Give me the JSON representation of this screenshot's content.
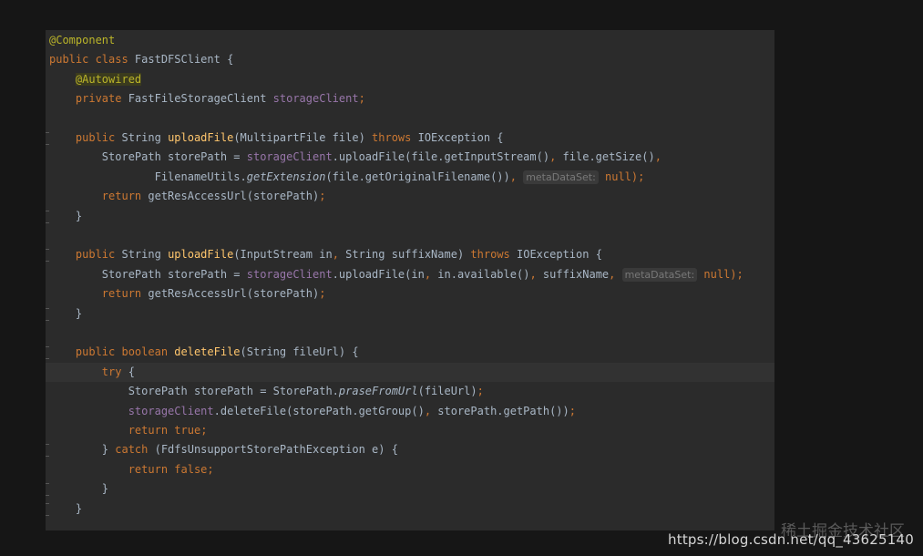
{
  "editor": {
    "lines": [
      {
        "tokens": [
          {
            "t": "@Component",
            "c": "ann"
          }
        ]
      },
      {
        "tokens": [
          {
            "t": "public class ",
            "c": "kw"
          },
          {
            "t": "FastDFSClient ",
            "c": "plain"
          },
          {
            "t": "{",
            "c": "plain"
          }
        ]
      },
      {
        "tokens": [
          {
            "t": "    ",
            "c": "plain"
          },
          {
            "t": "@Autowired",
            "c": "ann-hl"
          }
        ]
      },
      {
        "tokens": [
          {
            "t": "    ",
            "c": "plain"
          },
          {
            "t": "private ",
            "c": "kw"
          },
          {
            "t": "FastFileStorageClient ",
            "c": "plain"
          },
          {
            "t": "storageClient",
            "c": "field"
          },
          {
            "t": ";",
            "c": "punc"
          }
        ]
      },
      {
        "tokens": []
      },
      {
        "tokens": [
          {
            "t": "    ",
            "c": "plain"
          },
          {
            "t": "public ",
            "c": "kw"
          },
          {
            "t": "String ",
            "c": "plain"
          },
          {
            "t": "uploadFile",
            "c": "fn"
          },
          {
            "t": "(MultipartFile file) ",
            "c": "plain"
          },
          {
            "t": "throws ",
            "c": "kw"
          },
          {
            "t": "IOException {",
            "c": "plain"
          }
        ]
      },
      {
        "tokens": [
          {
            "t": "        ",
            "c": "plain"
          },
          {
            "t": "StorePath storePath = ",
            "c": "plain"
          },
          {
            "t": "storageClient",
            "c": "field"
          },
          {
            "t": ".uploadFile(file.getInputStream()",
            "c": "plain"
          },
          {
            "t": ", ",
            "c": "punc"
          },
          {
            "t": "file.getSize()",
            "c": "plain"
          },
          {
            "t": ",",
            "c": "punc"
          }
        ]
      },
      {
        "tokens": [
          {
            "t": "                ",
            "c": "plain"
          },
          {
            "t": "FilenameUtils.",
            "c": "plain"
          },
          {
            "t": "getExtension",
            "c": "static"
          },
          {
            "t": "(file.getOriginalFilename())",
            "c": "plain"
          },
          {
            "t": ", ",
            "c": "punc"
          },
          {
            "t": "metaDataSet:",
            "c": "hint"
          },
          {
            "t": " null",
            "c": "kw"
          },
          {
            "t": ");",
            "c": "punc"
          }
        ]
      },
      {
        "tokens": [
          {
            "t": "        ",
            "c": "plain"
          },
          {
            "t": "return ",
            "c": "kw"
          },
          {
            "t": "getResAccessUrl(storePath)",
            "c": "plain"
          },
          {
            "t": ";",
            "c": "punc"
          }
        ]
      },
      {
        "tokens": [
          {
            "t": "    }",
            "c": "plain"
          }
        ]
      },
      {
        "tokens": []
      },
      {
        "tokens": [
          {
            "t": "    ",
            "c": "plain"
          },
          {
            "t": "public ",
            "c": "kw"
          },
          {
            "t": "String ",
            "c": "plain"
          },
          {
            "t": "uploadFile",
            "c": "fn"
          },
          {
            "t": "(InputStream in",
            "c": "plain"
          },
          {
            "t": ", ",
            "c": "punc"
          },
          {
            "t": "String suffixName) ",
            "c": "plain"
          },
          {
            "t": "throws ",
            "c": "kw"
          },
          {
            "t": "IOException {",
            "c": "plain"
          }
        ]
      },
      {
        "tokens": [
          {
            "t": "        ",
            "c": "plain"
          },
          {
            "t": "StorePath storePath = ",
            "c": "plain"
          },
          {
            "t": "storageClient",
            "c": "field"
          },
          {
            "t": ".uploadFile(in",
            "c": "plain"
          },
          {
            "t": ", ",
            "c": "punc"
          },
          {
            "t": "in.available()",
            "c": "plain"
          },
          {
            "t": ", ",
            "c": "punc"
          },
          {
            "t": "suffixName",
            "c": "plain"
          },
          {
            "t": ", ",
            "c": "punc"
          },
          {
            "t": "metaDataSet:",
            "c": "hint"
          },
          {
            "t": " null",
            "c": "kw"
          },
          {
            "t": ");",
            "c": "punc"
          }
        ]
      },
      {
        "tokens": [
          {
            "t": "        ",
            "c": "plain"
          },
          {
            "t": "return ",
            "c": "kw"
          },
          {
            "t": "getResAccessUrl(storePath)",
            "c": "plain"
          },
          {
            "t": ";",
            "c": "punc"
          }
        ]
      },
      {
        "tokens": [
          {
            "t": "    }",
            "c": "plain"
          }
        ]
      },
      {
        "tokens": []
      },
      {
        "tokens": [
          {
            "t": "    ",
            "c": "plain"
          },
          {
            "t": "public boolean ",
            "c": "kw"
          },
          {
            "t": "deleteFile",
            "c": "fn"
          },
          {
            "t": "(String fileUrl) {",
            "c": "plain"
          }
        ]
      },
      {
        "tokens": [
          {
            "t": "        ",
            "c": "plain"
          },
          {
            "t": "try ",
            "c": "kw"
          },
          {
            "t": "{",
            "c": "plain"
          }
        ],
        "current": true
      },
      {
        "tokens": [
          {
            "t": "            ",
            "c": "plain"
          },
          {
            "t": "StorePath storePath = StorePath.",
            "c": "plain"
          },
          {
            "t": "praseFromUrl",
            "c": "static"
          },
          {
            "t": "(fileUrl)",
            "c": "plain"
          },
          {
            "t": ";",
            "c": "punc"
          }
        ]
      },
      {
        "tokens": [
          {
            "t": "            ",
            "c": "plain"
          },
          {
            "t": "storageClient",
            "c": "field"
          },
          {
            "t": ".deleteFile(storePath.getGroup()",
            "c": "plain"
          },
          {
            "t": ", ",
            "c": "punc"
          },
          {
            "t": "storePath.getPath())",
            "c": "plain"
          },
          {
            "t": ";",
            "c": "punc"
          }
        ]
      },
      {
        "tokens": [
          {
            "t": "            ",
            "c": "plain"
          },
          {
            "t": "return true",
            "c": "kw"
          },
          {
            "t": ";",
            "c": "punc"
          }
        ]
      },
      {
        "tokens": [
          {
            "t": "        ",
            "c": "plain"
          },
          {
            "t": "} ",
            "c": "plain"
          },
          {
            "t": "catch ",
            "c": "kw"
          },
          {
            "t": "(FdfsUnsupportStorePathException e) {",
            "c": "plain"
          }
        ]
      },
      {
        "tokens": [
          {
            "t": "            ",
            "c": "plain"
          },
          {
            "t": "return false",
            "c": "kw"
          },
          {
            "t": ";",
            "c": "punc"
          }
        ]
      },
      {
        "tokens": [
          {
            "t": "        }",
            "c": "plain"
          }
        ]
      },
      {
        "tokens": [
          {
            "t": "    }",
            "c": "plain"
          }
        ]
      }
    ]
  },
  "watermark": {
    "site": "稀土掘金技术社区",
    "url": "https://blog.csdn.net/qq_43625140"
  },
  "colors": {
    "background": "#2b2b2b",
    "keyword": "#cc7832",
    "annotation": "#bbb529",
    "method": "#ffc66d",
    "field": "#9876aa",
    "text": "#a9b7c6"
  }
}
